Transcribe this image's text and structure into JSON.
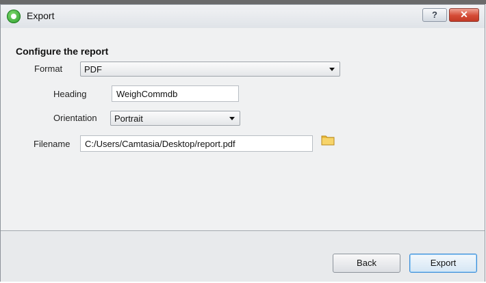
{
  "window": {
    "title": "Export",
    "help_label": "?",
    "close_label": "✕"
  },
  "form": {
    "section_title": "Configure the report",
    "format": {
      "label": "Format",
      "value": "PDF"
    },
    "heading": {
      "label": "Heading",
      "value": "WeighCommdb"
    },
    "orientation": {
      "label": "Orientation",
      "value": "Portrait"
    },
    "filename": {
      "label": "Filename",
      "value": "C:/Users/Camtasia/Desktop/report.pdf",
      "browse_icon": "folder-icon"
    }
  },
  "footer": {
    "back_label": "Back",
    "export_label": "Export"
  },
  "colors": {
    "title_bar": "#e6e9ee",
    "close_button": "#d44a35",
    "folder_icon": "#f2c94c",
    "default_button_border": "#3d8ed8"
  }
}
